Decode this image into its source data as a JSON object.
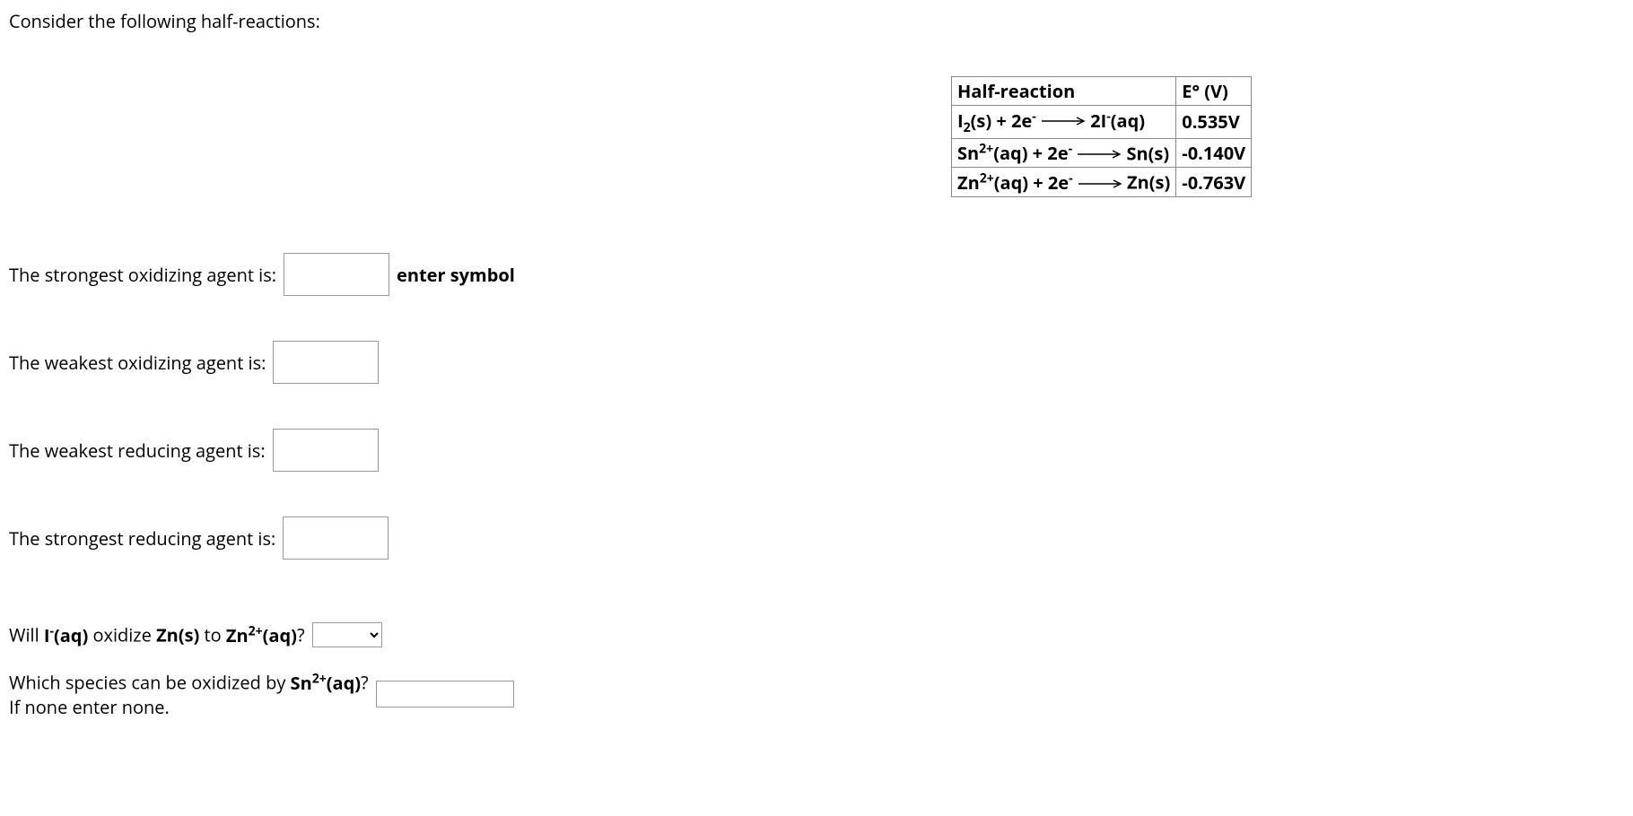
{
  "intro": "Consider the following half-reactions:",
  "table": {
    "headers": {
      "col1": "Half-reaction",
      "col2": "E° (V)"
    },
    "rows": [
      {
        "lhs_html": "I<sub>2</sub>(s) + 2e<sup>-</sup>",
        "rhs_html": "2I<sup>-</sup>(aq)",
        "e": "0.535V"
      },
      {
        "lhs_html": "Sn<sup>2+</sup>(aq) + 2e<sup>-</sup>",
        "rhs_html": "Sn(s)",
        "e": "-0.140V"
      },
      {
        "lhs_html": "Zn<sup>2+</sup>(aq) + 2e<sup>-</sup>",
        "rhs_html": "Zn(s)",
        "e": "-0.763V"
      }
    ]
  },
  "questions": {
    "q1": {
      "label": "The strongest oxidizing agent is:",
      "hint": "enter symbol"
    },
    "q2": {
      "label": "The weakest oxidizing agent is:"
    },
    "q3": {
      "label": "The weakest reducing agent is:"
    },
    "q4": {
      "label": "The strongest reducing agent is:"
    },
    "q5": {
      "pre": "Will ",
      "species1_html": "I<sup>-</sup>(aq)",
      "mid": " oxidize ",
      "species2_html": "Zn(s)",
      "to": " to ",
      "species3_html": "Zn<sup>2+</sup>(aq)",
      "post": "?"
    },
    "q6": {
      "line1_pre": "Which species can be oxidized by ",
      "species_html": "Sn<sup>2+</sup>(aq)",
      "line1_post": "?",
      "line2": "If none enter none."
    }
  }
}
